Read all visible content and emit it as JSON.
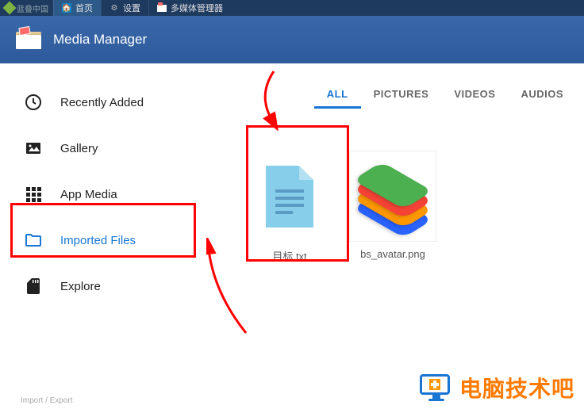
{
  "titlebar": {
    "logo_text": "蓝叠中国",
    "tabs": [
      {
        "label": "首页",
        "icon": "home"
      },
      {
        "label": "设置",
        "icon": "gear"
      },
      {
        "label": "多媒体管理器",
        "icon": "media"
      }
    ]
  },
  "header": {
    "title": "Media Manager"
  },
  "sidebar": {
    "items": [
      {
        "label": "Recently Added",
        "icon": "clock"
      },
      {
        "label": "Gallery",
        "icon": "image"
      },
      {
        "label": "App Media",
        "icon": "grid"
      },
      {
        "label": "Imported Files",
        "icon": "folder",
        "selected": true
      },
      {
        "label": "Explore",
        "icon": "sdcard"
      }
    ],
    "footer": "Import / Export"
  },
  "filters": {
    "items": [
      {
        "label": "ALL",
        "active": true
      },
      {
        "label": "PICTURES"
      },
      {
        "label": "VIDEOS"
      },
      {
        "label": "AUDIOS"
      }
    ]
  },
  "files": [
    {
      "name": "目标.txt",
      "kind": "document"
    },
    {
      "name": "bs_avatar.png",
      "kind": "image"
    }
  ],
  "watermark": {
    "text": "电脑技术吧"
  },
  "colors": {
    "accent": "#1976d2",
    "annotation": "#ff0000",
    "watermark": "#ff7a00"
  }
}
